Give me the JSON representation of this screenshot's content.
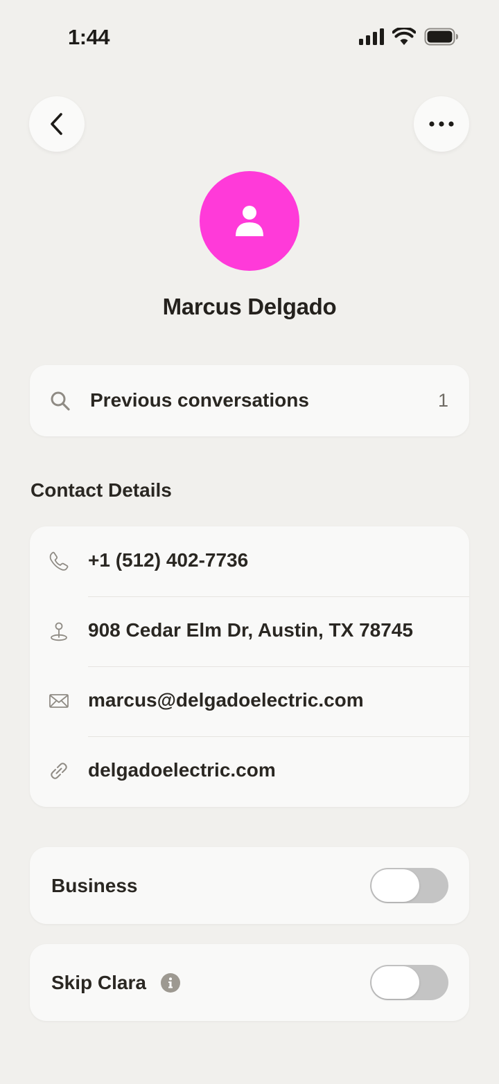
{
  "status_bar": {
    "time": "1:44",
    "icons": [
      "signal-icon",
      "wifi-icon",
      "battery-icon"
    ]
  },
  "header": {
    "back_icon": "chevron-left-icon",
    "more_icon": "ellipsis-icon"
  },
  "contact": {
    "name": "Marcus Delgado",
    "avatar_color": "#ff3ad9",
    "avatar_icon": "person-icon"
  },
  "previous_conversations": {
    "icon": "search-icon",
    "label": "Previous conversations",
    "count": "1"
  },
  "contact_details": {
    "title": "Contact Details",
    "items": [
      {
        "icon": "phone-icon",
        "value": "+1 (512) 402-7736"
      },
      {
        "icon": "location-pin-icon",
        "value": "908 Cedar Elm Dr, Austin, TX 78745"
      },
      {
        "icon": "mail-icon",
        "value": "marcus@delgadoelectric.com"
      },
      {
        "icon": "link-icon",
        "value": "delgadoelectric.com"
      }
    ]
  },
  "settings": {
    "business": {
      "label": "Business",
      "enabled": false
    },
    "skip_clara": {
      "label": "Skip Clara",
      "info_icon": "info-icon",
      "enabled": false
    }
  }
}
